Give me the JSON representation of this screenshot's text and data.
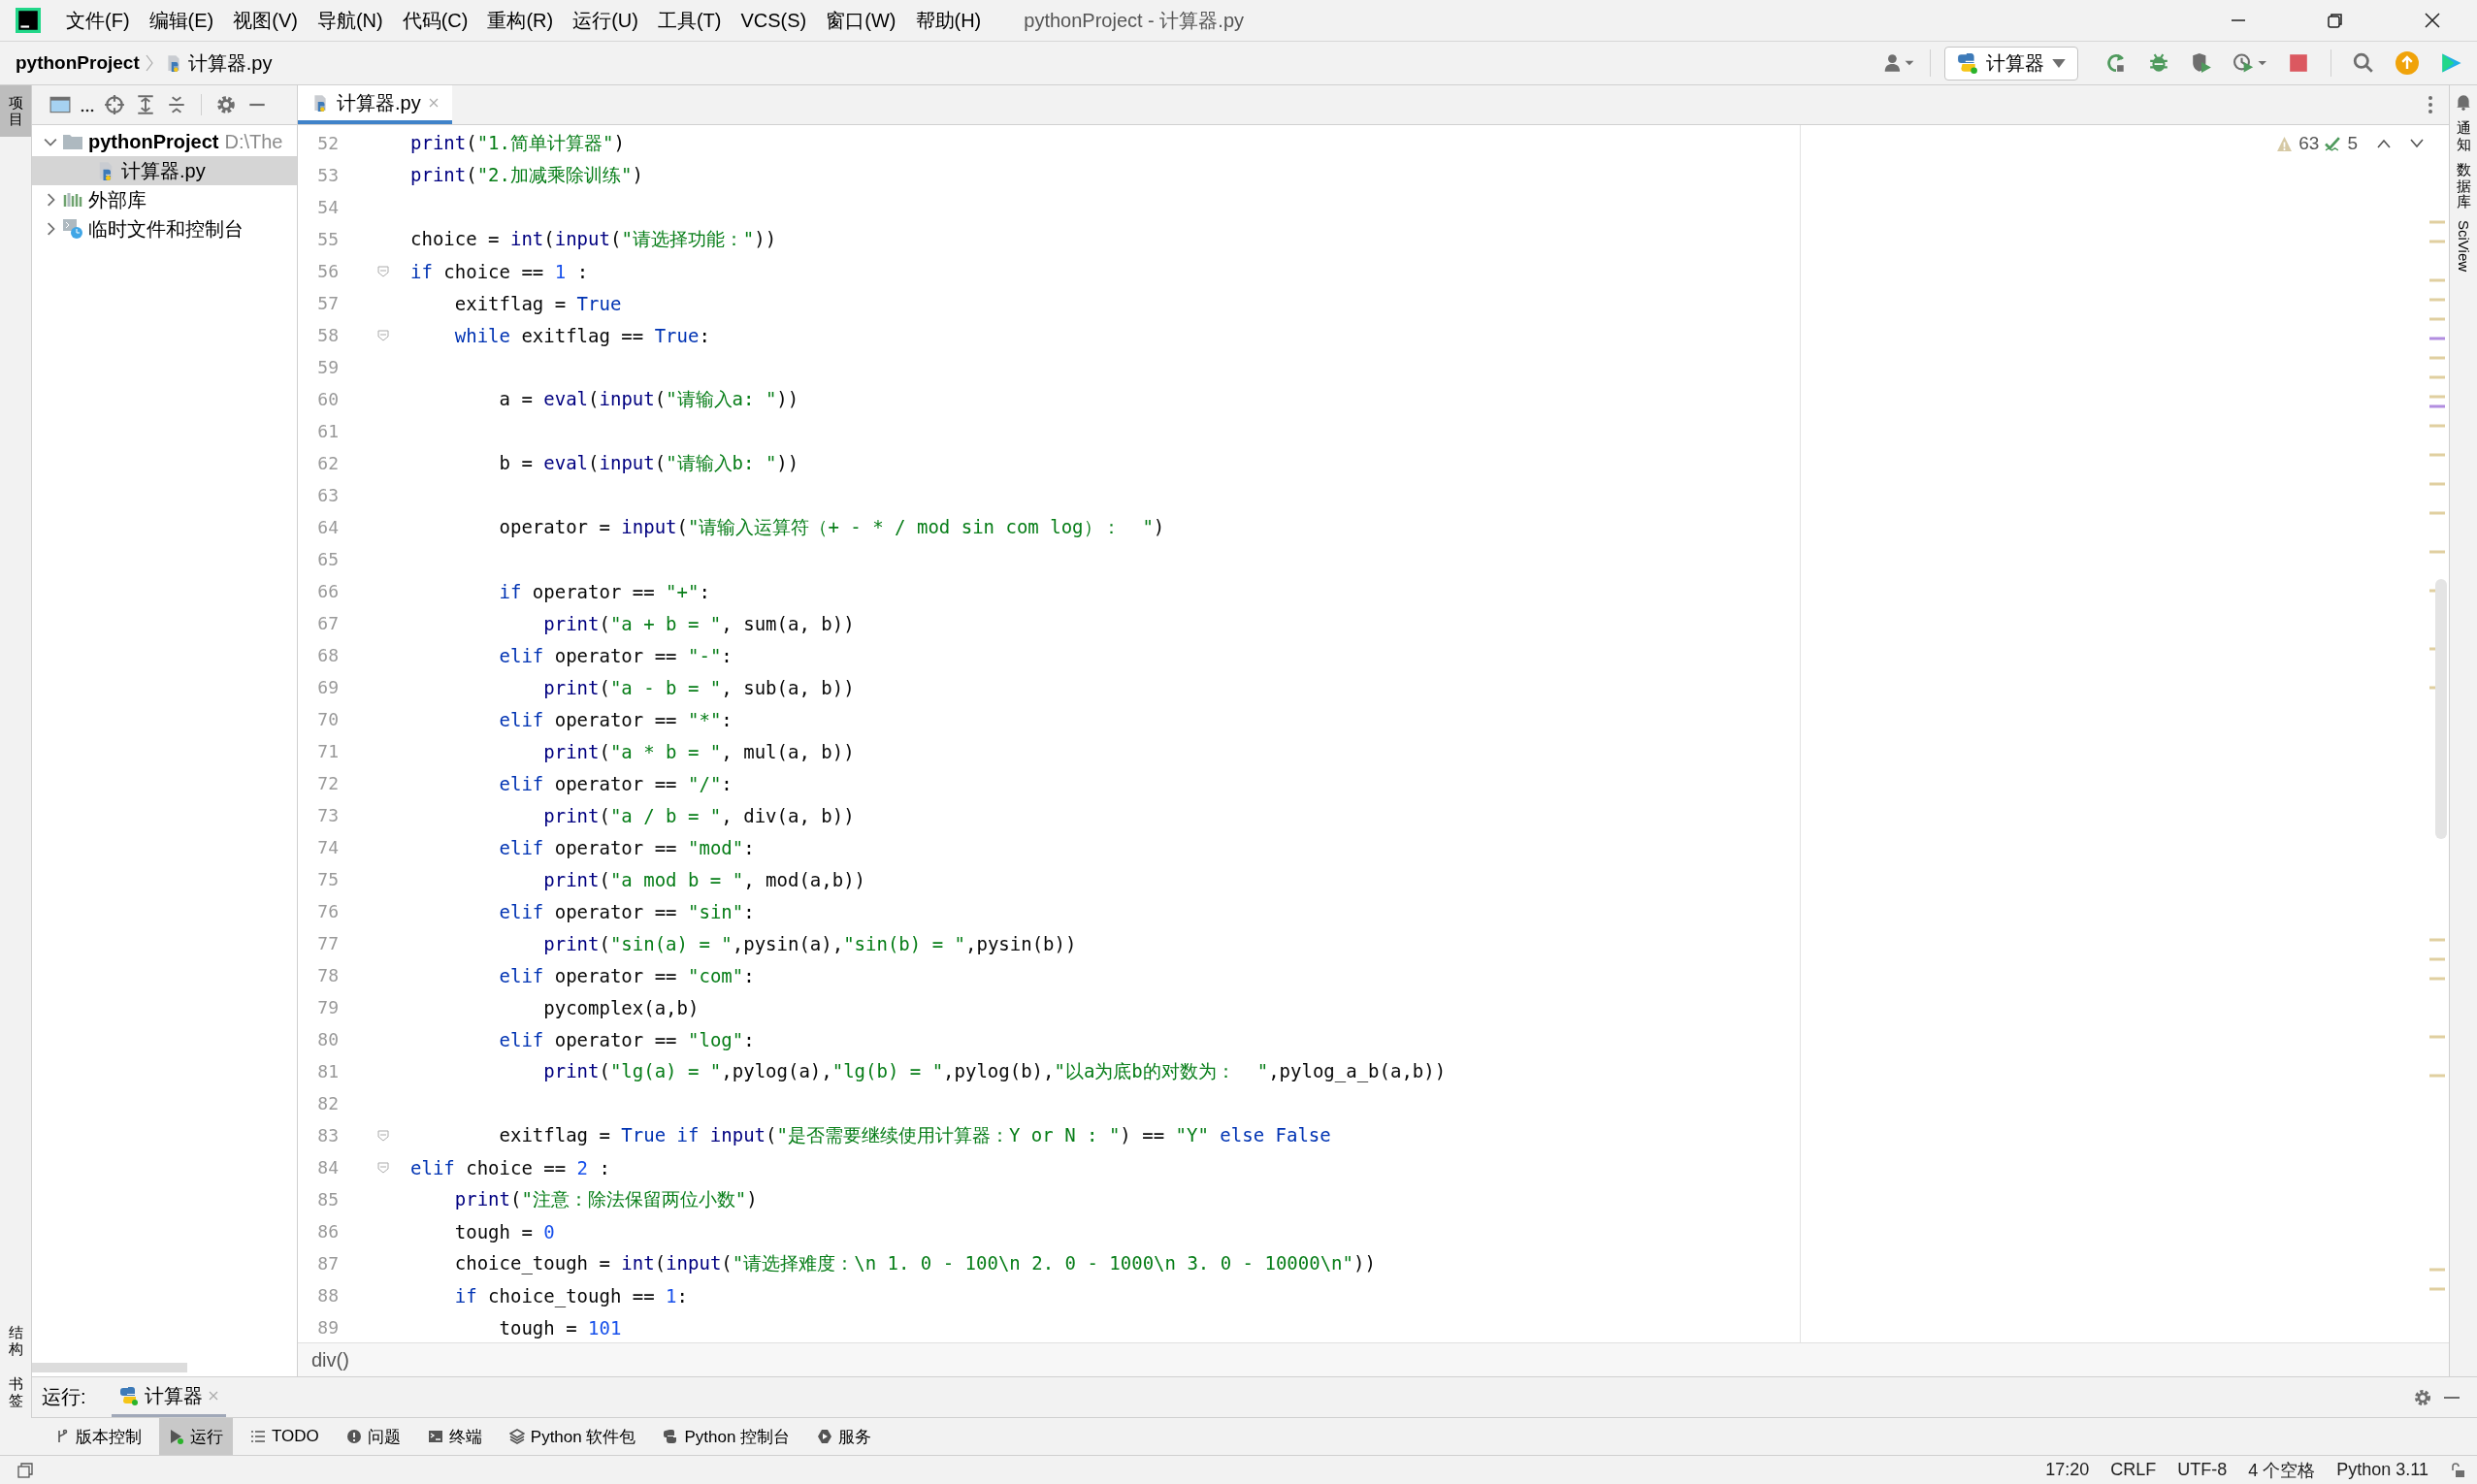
{
  "window": {
    "title": "pythonProject - 计算器.py"
  },
  "menu": [
    "文件(F)",
    "编辑(E)",
    "视图(V)",
    "导航(N)",
    "代码(C)",
    "重构(R)",
    "运行(U)",
    "工具(T)",
    "VCS(S)",
    "窗口(W)",
    "帮助(H)"
  ],
  "breadcrumb": {
    "project": "pythonProject",
    "file": "计算器.py"
  },
  "run_config": {
    "label": "计算器"
  },
  "left_stripe": {
    "top": "项目",
    "bottom": [
      "结构",
      "书签"
    ]
  },
  "right_stripe": [
    "通知",
    "数据库",
    "SciView"
  ],
  "project_tree": [
    {
      "label": "pythonProject",
      "path": "D:\\The",
      "kind": "folder",
      "expanded": true,
      "selected": false,
      "children": [
        {
          "label": "计算器.py",
          "kind": "pyfile",
          "selected": true
        }
      ]
    },
    {
      "label": "外部库",
      "kind": "library",
      "expanded": false,
      "selected": false
    },
    {
      "label": "临时文件和控制台",
      "kind": "scratch",
      "expanded": false,
      "selected": false
    }
  ],
  "editor_tabs": [
    {
      "label": "计算器.py",
      "selected": true
    }
  ],
  "inspections": {
    "warnings": "63",
    "weak_warnings": "5"
  },
  "code": [
    {
      "number": "52",
      "tokens": [
        {
          "kind": "builtin",
          "text": "print"
        },
        {
          "kind": "plain",
          "text": "("
        },
        {
          "kind": "str",
          "text": "\"1.简单计算器\""
        },
        {
          "kind": "plain",
          "text": ")"
        }
      ]
    },
    {
      "number": "53",
      "tokens": [
        {
          "kind": "builtin",
          "text": "print"
        },
        {
          "kind": "plain",
          "text": "("
        },
        {
          "kind": "str",
          "text": "\"2.加减乘除训练\""
        },
        {
          "kind": "plain",
          "text": ")"
        }
      ]
    },
    {
      "number": "54"
    },
    {
      "number": "55",
      "tokens": [
        {
          "kind": "plain",
          "text": "choice = "
        },
        {
          "kind": "builtin",
          "text": "int"
        },
        {
          "kind": "plain",
          "text": "("
        },
        {
          "kind": "builtin",
          "text": "input"
        },
        {
          "kind": "plain",
          "text": "("
        },
        {
          "kind": "str",
          "text": "\"请选择功能：\""
        },
        {
          "kind": "plain",
          "text": "))"
        }
      ]
    },
    {
      "number": "56",
      "fold": true,
      "tokens": [
        {
          "kind": "kw",
          "text": "if"
        },
        {
          "kind": "plain",
          "text": " choice == "
        },
        {
          "kind": "num",
          "text": "1"
        },
        {
          "kind": "plain",
          "text": " :"
        }
      ]
    },
    {
      "number": "57",
      "tokens": [
        {
          "kind": "plain",
          "text": "    exitflag = "
        },
        {
          "kind": "kw",
          "text": "True"
        }
      ]
    },
    {
      "number": "58",
      "fold": true,
      "tokens": [
        {
          "kind": "kw",
          "text": "    while"
        },
        {
          "kind": "plain",
          "text": " exitflag == "
        },
        {
          "kind": "kw",
          "text": "True"
        },
        {
          "kind": "plain",
          "text": ":"
        }
      ]
    },
    {
      "number": "59"
    },
    {
      "number": "60",
      "tokens": [
        {
          "kind": "plain",
          "text": "        a = "
        },
        {
          "kind": "builtin",
          "text": "eval"
        },
        {
          "kind": "plain",
          "text": "("
        },
        {
          "kind": "builtin",
          "text": "input"
        },
        {
          "kind": "plain",
          "text": "("
        },
        {
          "kind": "str",
          "text": "\"请输入a: \""
        },
        {
          "kind": "plain",
          "text": "))"
        }
      ]
    },
    {
      "number": "61"
    },
    {
      "number": "62",
      "tokens": [
        {
          "kind": "plain",
          "text": "        b = "
        },
        {
          "kind": "builtin",
          "text": "eval"
        },
        {
          "kind": "plain",
          "text": "("
        },
        {
          "kind": "builtin",
          "text": "input"
        },
        {
          "kind": "plain",
          "text": "("
        },
        {
          "kind": "str",
          "text": "\"请输入b: \""
        },
        {
          "kind": "plain",
          "text": "))"
        }
      ]
    },
    {
      "number": "63"
    },
    {
      "number": "64",
      "tokens": [
        {
          "kind": "plain",
          "text": "        operator = "
        },
        {
          "kind": "builtin",
          "text": "input"
        },
        {
          "kind": "plain",
          "text": "("
        },
        {
          "kind": "str",
          "text": "\"请输入运算符（+ - * / mod sin com log）：  \""
        },
        {
          "kind": "plain",
          "text": ")"
        }
      ]
    },
    {
      "number": "65"
    },
    {
      "number": "66",
      "tokens": [
        {
          "kind": "kw",
          "text": "        if"
        },
        {
          "kind": "plain",
          "text": " operator == "
        },
        {
          "kind": "str",
          "text": "\"+\""
        },
        {
          "kind": "plain",
          "text": ":"
        }
      ]
    },
    {
      "number": "67",
      "tokens": [
        {
          "kind": "builtin",
          "text": "            print"
        },
        {
          "kind": "plain",
          "text": "("
        },
        {
          "kind": "str",
          "text": "\"a + b = \""
        },
        {
          "kind": "plain",
          "text": ", sum(a, b))"
        }
      ]
    },
    {
      "number": "68",
      "tokens": [
        {
          "kind": "kw",
          "text": "        elif"
        },
        {
          "kind": "plain",
          "text": " operator == "
        },
        {
          "kind": "str",
          "text": "\"-\""
        },
        {
          "kind": "plain",
          "text": ":"
        }
      ]
    },
    {
      "number": "69",
      "tokens": [
        {
          "kind": "builtin",
          "text": "            print"
        },
        {
          "kind": "plain",
          "text": "("
        },
        {
          "kind": "str",
          "text": "\"a - b = \""
        },
        {
          "kind": "plain",
          "text": ", sub(a, b))"
        }
      ]
    },
    {
      "number": "70",
      "tokens": [
        {
          "kind": "kw",
          "text": "        elif"
        },
        {
          "kind": "plain",
          "text": " operator == "
        },
        {
          "kind": "str",
          "text": "\"*\""
        },
        {
          "kind": "plain",
          "text": ":"
        }
      ]
    },
    {
      "number": "71",
      "tokens": [
        {
          "kind": "builtin",
          "text": "            print"
        },
        {
          "kind": "plain",
          "text": "("
        },
        {
          "kind": "str",
          "text": "\"a * b = \""
        },
        {
          "kind": "plain",
          "text": ", mul(a, b))"
        }
      ]
    },
    {
      "number": "72",
      "tokens": [
        {
          "kind": "kw",
          "text": "        elif"
        },
        {
          "kind": "plain",
          "text": " operator == "
        },
        {
          "kind": "str",
          "text": "\"/\""
        },
        {
          "kind": "plain",
          "text": ":"
        }
      ]
    },
    {
      "number": "73",
      "tokens": [
        {
          "kind": "builtin",
          "text": "            print"
        },
        {
          "kind": "plain",
          "text": "("
        },
        {
          "kind": "str",
          "text": "\"a / b = \""
        },
        {
          "kind": "plain",
          "text": ", div(a, b))"
        }
      ]
    },
    {
      "number": "74",
      "tokens": [
        {
          "kind": "kw",
          "text": "        elif"
        },
        {
          "kind": "plain",
          "text": " operator == "
        },
        {
          "kind": "str",
          "text": "\"mod\""
        },
        {
          "kind": "plain",
          "text": ":"
        }
      ]
    },
    {
      "number": "75",
      "tokens": [
        {
          "kind": "builtin",
          "text": "            print"
        },
        {
          "kind": "plain",
          "text": "("
        },
        {
          "kind": "str",
          "text": "\"a mod b = \""
        },
        {
          "kind": "plain",
          "text": ", mod(a,b))"
        }
      ]
    },
    {
      "number": "76",
      "tokens": [
        {
          "kind": "kw",
          "text": "        elif"
        },
        {
          "kind": "plain",
          "text": " operator == "
        },
        {
          "kind": "str",
          "text": "\"sin\""
        },
        {
          "kind": "plain",
          "text": ":"
        }
      ]
    },
    {
      "number": "77",
      "tokens": [
        {
          "kind": "builtin",
          "text": "            print"
        },
        {
          "kind": "plain",
          "text": "("
        },
        {
          "kind": "str",
          "text": "\"sin(a) = \""
        },
        {
          "kind": "plain",
          "text": ",pysin(a),"
        },
        {
          "kind": "str",
          "text": "\"sin(b) = \""
        },
        {
          "kind": "plain",
          "text": ",pysin(b))"
        }
      ]
    },
    {
      "number": "78",
      "tokens": [
        {
          "kind": "kw",
          "text": "        elif"
        },
        {
          "kind": "plain",
          "text": " operator == "
        },
        {
          "kind": "str",
          "text": "\"com\""
        },
        {
          "kind": "plain",
          "text": ":"
        }
      ]
    },
    {
      "number": "79",
      "tokens": [
        {
          "kind": "plain",
          "text": "            pycomplex(a,b)"
        }
      ]
    },
    {
      "number": "80",
      "tokens": [
        {
          "kind": "kw",
          "text": "        elif"
        },
        {
          "kind": "plain",
          "text": " operator == "
        },
        {
          "kind": "str",
          "text": "\"log\""
        },
        {
          "kind": "plain",
          "text": ":"
        }
      ]
    },
    {
      "number": "81",
      "tokens": [
        {
          "kind": "builtin",
          "text": "            print"
        },
        {
          "kind": "plain",
          "text": "("
        },
        {
          "kind": "str",
          "text": "\"lg(a) = \""
        },
        {
          "kind": "plain",
          "text": ",pylog(a),"
        },
        {
          "kind": "str",
          "text": "\"lg(b) = \""
        },
        {
          "kind": "plain",
          "text": ",pylog(b),"
        },
        {
          "kind": "str",
          "text": "\"以a为底b的对数为：  \""
        },
        {
          "kind": "plain",
          "text": ",pylog_a_b(a,b))"
        }
      ]
    },
    {
      "number": "82"
    },
    {
      "number": "83",
      "fold": true,
      "tokens": [
        {
          "kind": "plain",
          "text": "        exitflag = "
        },
        {
          "kind": "kw",
          "text": "True if "
        },
        {
          "kind": "builtin",
          "text": "input"
        },
        {
          "kind": "plain",
          "text": "("
        },
        {
          "kind": "str",
          "text": "\"是否需要继续使用计算器：Y or N : \""
        },
        {
          "kind": "plain",
          "text": ") == "
        },
        {
          "kind": "str",
          "text": "\"Y\""
        },
        {
          "kind": "kw",
          "text": " else False"
        }
      ]
    },
    {
      "number": "84",
      "fold": true,
      "tokens": [
        {
          "kind": "kw",
          "text": "elif"
        },
        {
          "kind": "plain",
          "text": " choice == "
        },
        {
          "kind": "num",
          "text": "2"
        },
        {
          "kind": "plain",
          "text": " :"
        }
      ]
    },
    {
      "number": "85",
      "tokens": [
        {
          "kind": "builtin",
          "text": "    print"
        },
        {
          "kind": "plain",
          "text": "("
        },
        {
          "kind": "str",
          "text": "\"注意：除法保留两位小数\""
        },
        {
          "kind": "plain",
          "text": ")"
        }
      ]
    },
    {
      "number": "86",
      "tokens": [
        {
          "kind": "plain",
          "text": "    tough = "
        },
        {
          "kind": "num",
          "text": "0"
        }
      ]
    },
    {
      "number": "87",
      "tokens": [
        {
          "kind": "plain",
          "text": "    choice_tough = "
        },
        {
          "kind": "builtin",
          "text": "int"
        },
        {
          "kind": "plain",
          "text": "("
        },
        {
          "kind": "builtin",
          "text": "input"
        },
        {
          "kind": "plain",
          "text": "("
        },
        {
          "kind": "str",
          "text": "\"请选择难度：\\n 1. 0 - 100\\n 2. 0 - 1000\\n 3. 0 - 10000\\n\""
        },
        {
          "kind": "plain",
          "text": "))"
        }
      ]
    },
    {
      "number": "88",
      "tokens": [
        {
          "kind": "kw",
          "text": "    if"
        },
        {
          "kind": "plain",
          "text": " choice_tough == "
        },
        {
          "kind": "num",
          "text": "1"
        },
        {
          "kind": "plain",
          "text": ":"
        }
      ]
    },
    {
      "number": "89",
      "tokens": [
        {
          "kind": "plain",
          "text": "        tough = "
        },
        {
          "kind": "num",
          "text": "101"
        }
      ]
    }
  ],
  "editor_breadcrumb": "div()",
  "run_panel": {
    "label": "运行:",
    "tabs": [
      {
        "label": "计算器",
        "selected": true
      }
    ]
  },
  "tool_windows": [
    {
      "label": "版本控制",
      "kind": "vcs",
      "selected": false
    },
    {
      "label": "运行",
      "kind": "run",
      "selected": true
    },
    {
      "label": "TODO",
      "kind": "list",
      "selected": false
    },
    {
      "label": "问题",
      "kind": "problems",
      "selected": false
    },
    {
      "label": "终端",
      "kind": "terminal",
      "selected": false
    },
    {
      "label": "Python 软件包",
      "kind": "packages",
      "selected": false
    },
    {
      "label": "Python 控制台",
      "kind": "python",
      "selected": false
    },
    {
      "label": "服务",
      "kind": "services",
      "selected": false
    }
  ],
  "status_bar": [
    "17:20",
    "CRLF",
    "UTF-8",
    "4 个空格",
    "Python 3.11"
  ]
}
